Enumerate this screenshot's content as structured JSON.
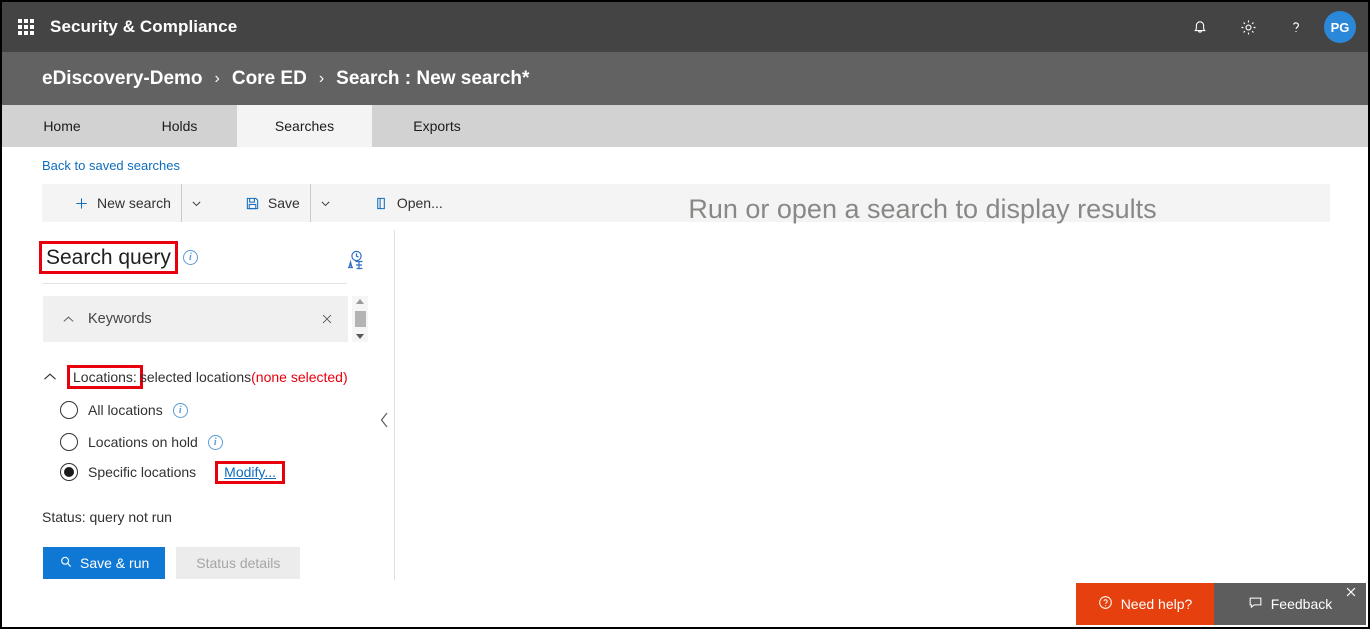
{
  "suite": {
    "waffle_icon": "app-launcher-icon",
    "title": "Security & Compliance",
    "icons": [
      {
        "name": "notification-bell-icon",
        "glyph": "bell"
      },
      {
        "name": "settings-gear-icon",
        "glyph": "gear"
      },
      {
        "name": "help-question-icon",
        "glyph": "question"
      }
    ],
    "avatar_initials": "PG"
  },
  "breadcrumb": {
    "items": [
      "eDiscovery-Demo",
      "Core ED",
      "Search : New search*"
    ],
    "separator": "›"
  },
  "tabs": [
    {
      "label": "Home",
      "active": false
    },
    {
      "label": "Holds",
      "active": false
    },
    {
      "label": "Searches",
      "active": true
    },
    {
      "label": "Exports",
      "active": false
    }
  ],
  "back_link": "Back to saved searches",
  "command_bar": {
    "new_search": "New search",
    "save": "Save",
    "open": "Open...",
    "chevron": "⌄"
  },
  "search_query": {
    "title": "Search query",
    "info_glyph": "i",
    "language_icon": "translate-language-icon",
    "keywords": {
      "label": "Keywords",
      "collapse_glyph": "∧",
      "close_glyph": "✕"
    }
  },
  "locations": {
    "collapse_glyph": "∧",
    "label_boxed": "Locations:",
    "label_rest": " selected locations ",
    "none_selected": "(none selected)",
    "options": [
      {
        "label": "All locations",
        "selected": false,
        "has_info": true
      },
      {
        "label": "Locations on hold",
        "selected": false,
        "has_info": true
      },
      {
        "label": "Specific locations",
        "selected": true,
        "has_info": false
      }
    ],
    "modify_link": "Modify..."
  },
  "status": {
    "text": "Status: query not run",
    "save_and_run": "Save & run",
    "status_details": "Status details"
  },
  "main": {
    "empty_message": "Run or open a search to display results"
  },
  "help_bar": {
    "need_help": "Need help?",
    "feedback": "Feedback",
    "close_glyph": "✕"
  },
  "colors": {
    "suite_bar": "#444444",
    "breadcrumb_bar": "#626262",
    "tab_bar": "#d2d2d2",
    "tab_active": "#f4f4f4",
    "accent_blue": "#0f78d4",
    "link_blue": "#0f6cbd",
    "highlight_red": "#e8000d",
    "need_help_orange": "#e5400d",
    "feedback_gray": "#5d5d5d",
    "avatar_blue": "#2b88d8"
  }
}
